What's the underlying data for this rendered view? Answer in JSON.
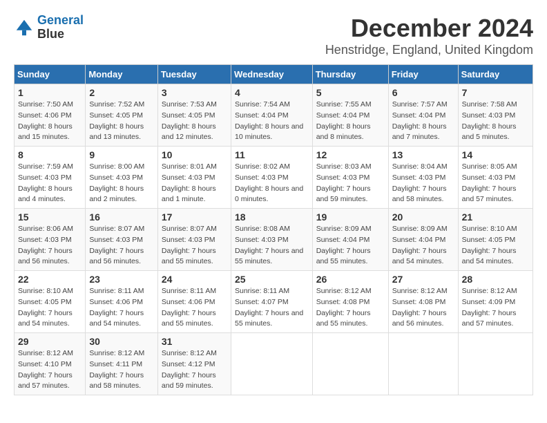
{
  "logo": {
    "line1": "General",
    "line2": "Blue"
  },
  "title": "December 2024",
  "subtitle": "Henstridge, England, United Kingdom",
  "colors": {
    "header_bg": "#2a6faf",
    "header_text": "#ffffff"
  },
  "columns": [
    "Sunday",
    "Monday",
    "Tuesday",
    "Wednesday",
    "Thursday",
    "Friday",
    "Saturday"
  ],
  "weeks": [
    [
      {
        "day": 1,
        "sunrise": "7:50 AM",
        "sunset": "4:06 PM",
        "daylight": "8 hours and 15 minutes."
      },
      {
        "day": 2,
        "sunrise": "7:52 AM",
        "sunset": "4:05 PM",
        "daylight": "8 hours and 13 minutes."
      },
      {
        "day": 3,
        "sunrise": "7:53 AM",
        "sunset": "4:05 PM",
        "daylight": "8 hours and 12 minutes."
      },
      {
        "day": 4,
        "sunrise": "7:54 AM",
        "sunset": "4:04 PM",
        "daylight": "8 hours and 10 minutes."
      },
      {
        "day": 5,
        "sunrise": "7:55 AM",
        "sunset": "4:04 PM",
        "daylight": "8 hours and 8 minutes."
      },
      {
        "day": 6,
        "sunrise": "7:57 AM",
        "sunset": "4:04 PM",
        "daylight": "8 hours and 7 minutes."
      },
      {
        "day": 7,
        "sunrise": "7:58 AM",
        "sunset": "4:03 PM",
        "daylight": "8 hours and 5 minutes."
      }
    ],
    [
      {
        "day": 8,
        "sunrise": "7:59 AM",
        "sunset": "4:03 PM",
        "daylight": "8 hours and 4 minutes."
      },
      {
        "day": 9,
        "sunrise": "8:00 AM",
        "sunset": "4:03 PM",
        "daylight": "8 hours and 2 minutes."
      },
      {
        "day": 10,
        "sunrise": "8:01 AM",
        "sunset": "4:03 PM",
        "daylight": "8 hours and 1 minute."
      },
      {
        "day": 11,
        "sunrise": "8:02 AM",
        "sunset": "4:03 PM",
        "daylight": "8 hours and 0 minutes."
      },
      {
        "day": 12,
        "sunrise": "8:03 AM",
        "sunset": "4:03 PM",
        "daylight": "7 hours and 59 minutes."
      },
      {
        "day": 13,
        "sunrise": "8:04 AM",
        "sunset": "4:03 PM",
        "daylight": "7 hours and 58 minutes."
      },
      {
        "day": 14,
        "sunrise": "8:05 AM",
        "sunset": "4:03 PM",
        "daylight": "7 hours and 57 minutes."
      }
    ],
    [
      {
        "day": 15,
        "sunrise": "8:06 AM",
        "sunset": "4:03 PM",
        "daylight": "7 hours and 56 minutes."
      },
      {
        "day": 16,
        "sunrise": "8:07 AM",
        "sunset": "4:03 PM",
        "daylight": "7 hours and 56 minutes."
      },
      {
        "day": 17,
        "sunrise": "8:07 AM",
        "sunset": "4:03 PM",
        "daylight": "7 hours and 55 minutes."
      },
      {
        "day": 18,
        "sunrise": "8:08 AM",
        "sunset": "4:03 PM",
        "daylight": "7 hours and 55 minutes."
      },
      {
        "day": 19,
        "sunrise": "8:09 AM",
        "sunset": "4:04 PM",
        "daylight": "7 hours and 55 minutes."
      },
      {
        "day": 20,
        "sunrise": "8:09 AM",
        "sunset": "4:04 PM",
        "daylight": "7 hours and 54 minutes."
      },
      {
        "day": 21,
        "sunrise": "8:10 AM",
        "sunset": "4:05 PM",
        "daylight": "7 hours and 54 minutes."
      }
    ],
    [
      {
        "day": 22,
        "sunrise": "8:10 AM",
        "sunset": "4:05 PM",
        "daylight": "7 hours and 54 minutes."
      },
      {
        "day": 23,
        "sunrise": "8:11 AM",
        "sunset": "4:06 PM",
        "daylight": "7 hours and 54 minutes."
      },
      {
        "day": 24,
        "sunrise": "8:11 AM",
        "sunset": "4:06 PM",
        "daylight": "7 hours and 55 minutes."
      },
      {
        "day": 25,
        "sunrise": "8:11 AM",
        "sunset": "4:07 PM",
        "daylight": "7 hours and 55 minutes."
      },
      {
        "day": 26,
        "sunrise": "8:12 AM",
        "sunset": "4:08 PM",
        "daylight": "7 hours and 55 minutes."
      },
      {
        "day": 27,
        "sunrise": "8:12 AM",
        "sunset": "4:08 PM",
        "daylight": "7 hours and 56 minutes."
      },
      {
        "day": 28,
        "sunrise": "8:12 AM",
        "sunset": "4:09 PM",
        "daylight": "7 hours and 57 minutes."
      }
    ],
    [
      {
        "day": 29,
        "sunrise": "8:12 AM",
        "sunset": "4:10 PM",
        "daylight": "7 hours and 57 minutes."
      },
      {
        "day": 30,
        "sunrise": "8:12 AM",
        "sunset": "4:11 PM",
        "daylight": "7 hours and 58 minutes."
      },
      {
        "day": 31,
        "sunrise": "8:12 AM",
        "sunset": "4:12 PM",
        "daylight": "7 hours and 59 minutes."
      },
      null,
      null,
      null,
      null
    ]
  ]
}
